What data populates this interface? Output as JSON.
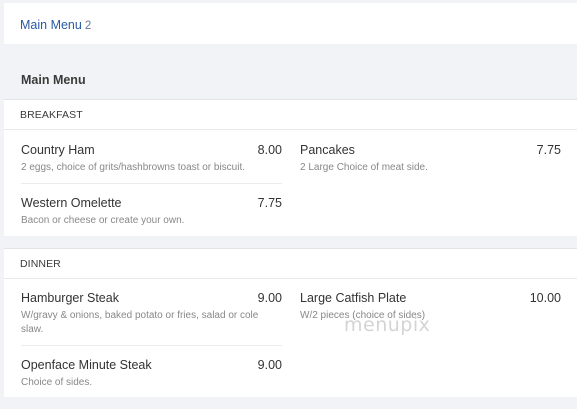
{
  "header": {
    "menu_link_label": "Main Menu",
    "menu_count": "2"
  },
  "main": {
    "title": "Main Menu",
    "sections": [
      {
        "name": "BREAKFAST",
        "items": [
          {
            "name": "Country Ham",
            "price": "8.00",
            "description": "2 eggs, choice of grits/hashbrowns toast or biscuit."
          },
          {
            "name": "Pancakes",
            "price": "7.75",
            "description": "2 Large Choice of meat side."
          },
          {
            "name": "Western Omelette",
            "price": "7.75",
            "description": "Bacon or cheese or create your own."
          }
        ]
      },
      {
        "name": "DINNER",
        "items": [
          {
            "name": "Hamburger Steak",
            "price": "9.00",
            "description_line1": "W/gravy & onions, baked potato or fries, salad or cole",
            "description_line2": "slaw."
          },
          {
            "name": "Large Catfish Plate",
            "price": "10.00",
            "description": "W/2 pieces (choice of sides)"
          },
          {
            "name": "Openface Minute Steak",
            "price": "9.00",
            "description": "Choice of sides."
          }
        ]
      }
    ]
  },
  "watermark": "menupix"
}
